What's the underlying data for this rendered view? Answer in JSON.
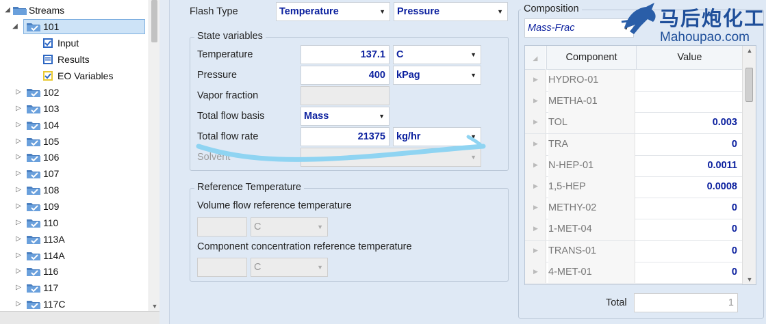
{
  "tree": {
    "root_label": "Streams",
    "selected_label": "101",
    "children": [
      "Input",
      "Results",
      "EO Variables"
    ],
    "items": [
      "102",
      "103",
      "104",
      "105",
      "106",
      "107",
      "108",
      "109",
      "110",
      "113A",
      "114A",
      "116",
      "117",
      "117C"
    ]
  },
  "flash": {
    "label": "Flash Type",
    "type1": "Temperature",
    "type2": "Pressure"
  },
  "state": {
    "title": "State variables",
    "temperature_label": "Temperature",
    "temperature_value": "137.1",
    "temperature_unit": "C",
    "pressure_label": "Pressure",
    "pressure_value": "400",
    "pressure_unit": "kPag",
    "vapor_label": "Vapor fraction",
    "basis_label": "Total flow basis",
    "basis_value": "Mass",
    "flowrate_label": "Total flow rate",
    "flowrate_value": "21375",
    "flowrate_unit": "kg/hr",
    "solvent_label": "Solvent"
  },
  "reference": {
    "title": "Reference Temperature",
    "volume_label": "Volume flow reference temperature",
    "volume_unit": "C",
    "component_label": "Component concentration reference temperature",
    "component_unit": "C"
  },
  "composition": {
    "title": "Composition",
    "basis": "Mass-Frac",
    "col_component": "Component",
    "col_value": "Value",
    "rows": [
      {
        "name": "HYDRO-01",
        "value": ""
      },
      {
        "name": "METHA-01",
        "value": ""
      },
      {
        "name": "TOL",
        "value": "0.003"
      },
      {
        "name": "TRA",
        "value": "0"
      },
      {
        "name": "N-HEP-01",
        "value": "0.0011"
      },
      {
        "name": "1,5-HEP",
        "value": "0.0008"
      },
      {
        "name": "METHY-02",
        "value": "0"
      },
      {
        "name": "1-MET-04",
        "value": "0"
      },
      {
        "name": "TRANS-01",
        "value": "0"
      },
      {
        "name": "4-MET-01",
        "value": "0"
      }
    ],
    "total_label": "Total",
    "total_value": "1"
  },
  "watermark": {
    "cn": "马后炮化工",
    "en": "Mahoupao.com"
  },
  "colors": {
    "value_blue": "#0a1f9e",
    "panel_bg": "#dfe9f5",
    "annotation": "#8fd4f2"
  }
}
